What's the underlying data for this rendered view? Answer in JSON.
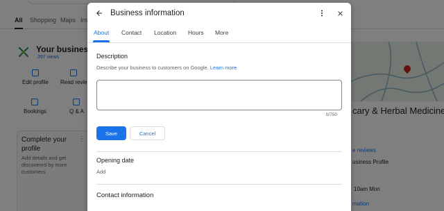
{
  "background": {
    "tabs": [
      "All",
      "Shopping",
      "Maps",
      "Im"
    ],
    "business_name": "Your business o",
    "views": "397 views",
    "actions": [
      "Edit profile",
      "Read revie",
      "Bookings",
      "Q & A"
    ],
    "card": {
      "title": "Complete your profile",
      "text": "Add details and get discovered by more customers"
    },
    "title_fragment": "cary & Herbal Medicine",
    "link_reviews": "e reviews",
    "profile_text": "usiness Profile",
    "hours_text": "10am Mon",
    "information_link": "mation"
  },
  "dialog": {
    "title": "Business information",
    "tabs": [
      "About",
      "Contact",
      "Location",
      "Hours",
      "More"
    ],
    "active_tab": "About",
    "description": {
      "heading": "Description",
      "help": "Describe your business to customers on Google.",
      "learn_more": "Learn more",
      "value": "",
      "counter": "0/750"
    },
    "save_label": "Save",
    "cancel_label": "Cancel",
    "opening_date": {
      "heading": "Opening date",
      "add_label": "Add"
    },
    "contact_heading": "Contact information"
  },
  "colors": {
    "accent": "#1a73e8",
    "scrim": "rgba(0,0,0,0.5)",
    "pin": "#c5221f"
  },
  "icons": {
    "back": "arrow-left-icon",
    "more": "more-vert-icon",
    "close": "close-icon"
  }
}
